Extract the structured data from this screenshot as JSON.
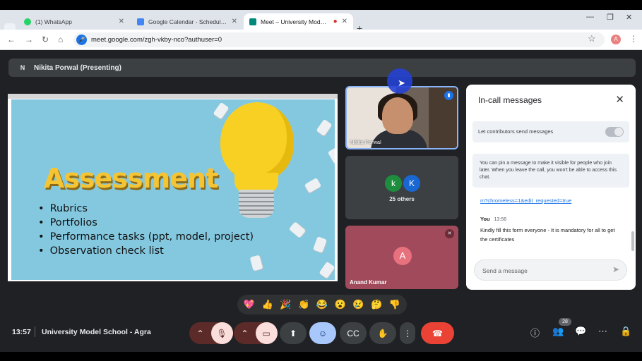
{
  "browser": {
    "tabs": [
      {
        "title": "(1) WhatsApp",
        "favicon": "whatsapp-icon",
        "color": "#25d366"
      },
      {
        "title": "Google Calendar - Schedule sta",
        "favicon": "calendar-icon",
        "color": "#4285f4"
      },
      {
        "title": "Meet – University Model Sc",
        "favicon": "meet-icon",
        "color": "#00897b"
      }
    ],
    "url": "meet.google.com/zgh-vkby-nco?authuser=0",
    "profile_initial": "A"
  },
  "presenting_bar": {
    "initial": "N",
    "label": "Nikita Porwal (Presenting)"
  },
  "slide": {
    "title": "Assessment",
    "bullets": [
      "Rubrics",
      "Portfolios",
      "Performance tasks (ppt, model, project)",
      "Observation check list"
    ]
  },
  "participants": {
    "tile1_name": "Nikita Porwal",
    "avatars": [
      "k",
      "K"
    ],
    "others": "25 others",
    "tile3_initial": "A",
    "tile3_name": "Anand Kumar"
  },
  "chat": {
    "header": "In-call messages",
    "toggle_label": "Let contributors send messages",
    "pin_notice": "You can pin a message to make it visible for people who join later. When you leave the call, you won't be able to access this chat.",
    "link": "m?chromeless=1&edit_requested=true",
    "sender": "You",
    "sent_time": "13:56",
    "message": "Kindly fill this form everyone - It is mandatory for all to get the certificates",
    "input_placeholder": "Send a message"
  },
  "reactions": [
    "💖",
    "👍",
    "🎉",
    "👏",
    "😂",
    "😮",
    "😢",
    "🤔",
    "👎"
  ],
  "bottom": {
    "time": "13:57",
    "meeting_name": "University Model School - Agra",
    "participant_count": "28"
  },
  "colors": {
    "accent": "#8ab4f8",
    "end_call": "#ea4335",
    "muted_control": "#f9dedc",
    "active_control": "#a8c7fa"
  }
}
